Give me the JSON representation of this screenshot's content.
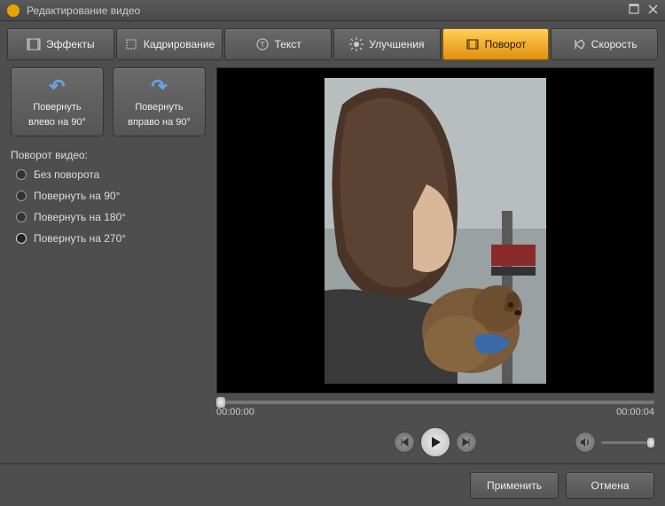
{
  "window": {
    "title": "Редактирование видео"
  },
  "tabs": [
    {
      "label": "Эффекты",
      "icon": "effects-icon"
    },
    {
      "label": "Кадрирование",
      "icon": "crop-icon"
    },
    {
      "label": "Текст",
      "icon": "text-icon"
    },
    {
      "label": "Улучшения",
      "icon": "enhance-icon"
    },
    {
      "label": "Поворот",
      "icon": "rotate-icon",
      "active": true
    },
    {
      "label": "Скорость",
      "icon": "speed-icon"
    }
  ],
  "rotate_buttons": {
    "left": {
      "line1": "Повернуть",
      "line2": "влево  на 90°"
    },
    "right": {
      "line1": "Повернуть",
      "line2": "вправо на 90°"
    }
  },
  "rotation": {
    "section_label": "Поворот видео:",
    "options": [
      {
        "label": "Без поворота",
        "selected": false
      },
      {
        "label": "Повернуть на 90°",
        "selected": false
      },
      {
        "label": "Повернуть на 180°",
        "selected": false
      },
      {
        "label": "Повернуть на 270°",
        "selected": true
      }
    ]
  },
  "timeline": {
    "start": "00:00:00",
    "end": "00:00:04",
    "position": 0
  },
  "volume": {
    "level": 100
  },
  "footer": {
    "apply": "Применить",
    "cancel": "Отмена"
  }
}
